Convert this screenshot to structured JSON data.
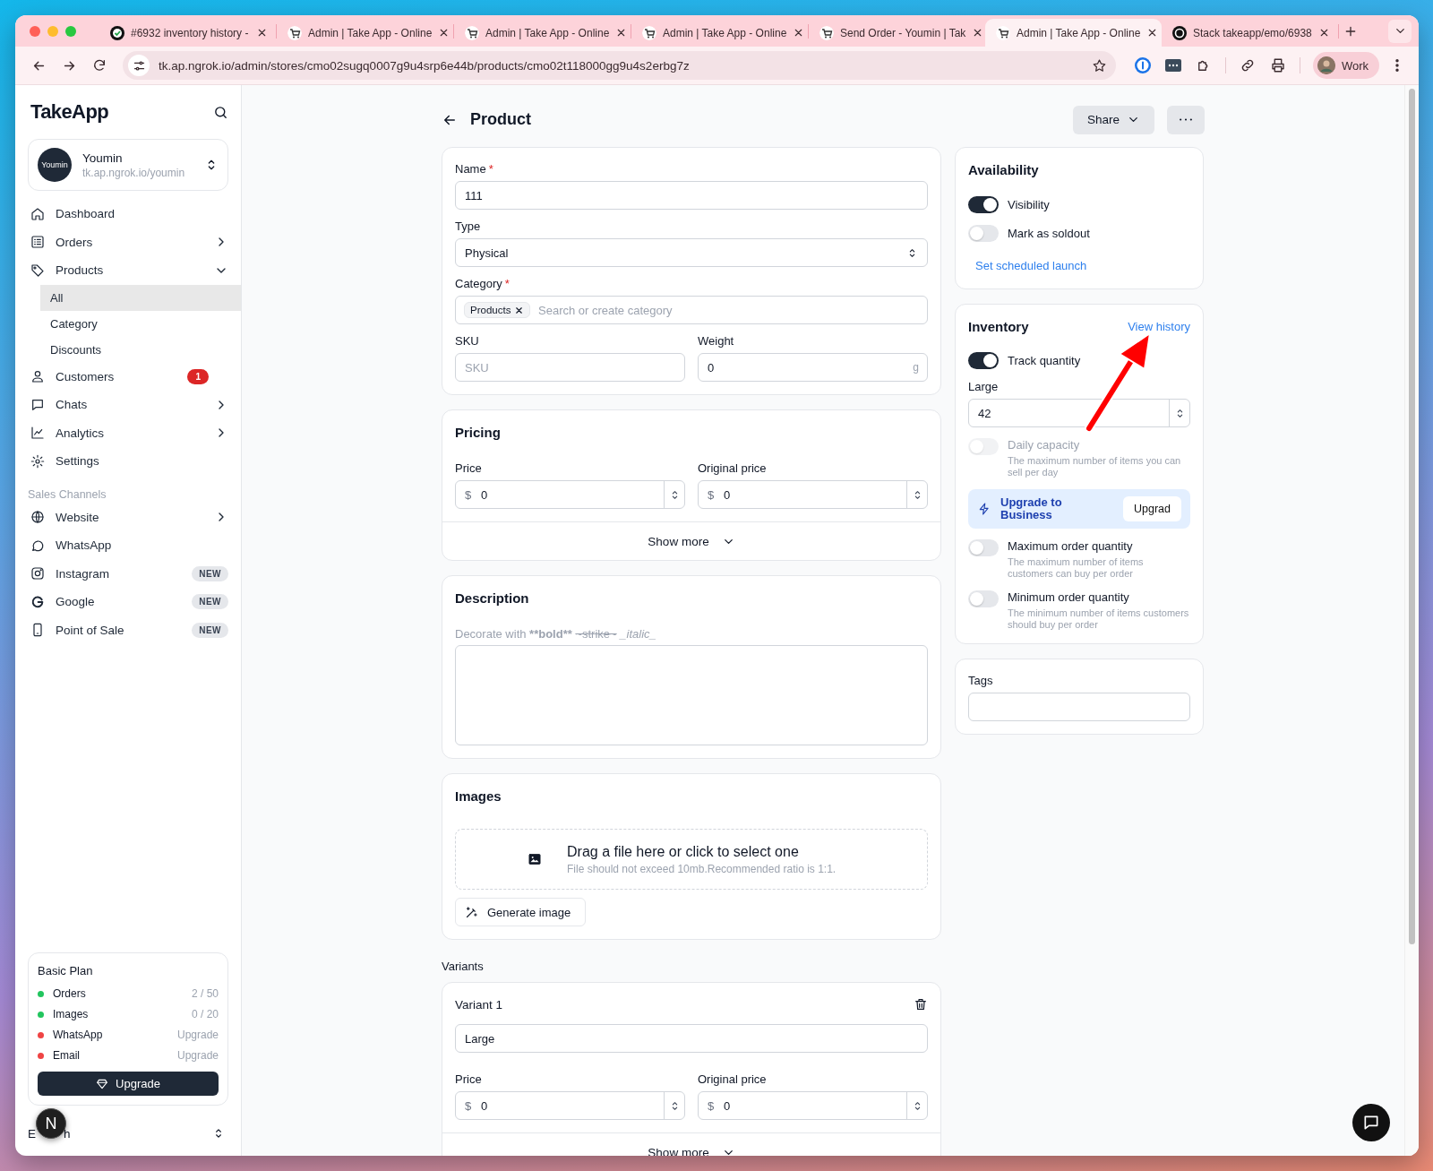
{
  "browser": {
    "tabs": [
      {
        "kind": "badge",
        "title": "#6932 inventory history -",
        "selected": false
      },
      {
        "kind": "cart",
        "title": "Admin | Take App - Online",
        "selected": false
      },
      {
        "kind": "cart",
        "title": "Admin | Take App - Online",
        "selected": false
      },
      {
        "kind": "cart",
        "title": "Admin | Take App - Online",
        "selected": false
      },
      {
        "kind": "cart",
        "title": "Send Order - Youmin | Tak",
        "selected": false
      },
      {
        "kind": "cart",
        "title": "Admin | Take App - Online",
        "selected": true
      },
      {
        "kind": "logo",
        "title": "Stack takeapp/emo/6938",
        "selected": false
      }
    ],
    "url": "tk.ap.ngrok.io/admin/stores/cmo02sugq0007g9u4srp6e44b/products/cmo02t118000gg9u4s2erbg7z",
    "profile": "Work"
  },
  "sidebar": {
    "logo": "TakeApp",
    "store": {
      "avatar": "Youmin",
      "name": "Youmin",
      "url": "tk.ap.ngrok.io/youmin"
    },
    "nav": [
      {
        "kind": "link",
        "label": "Dashboard",
        "selected": false
      },
      {
        "kind": "group",
        "label": "Orders",
        "expanded": false,
        "selected": false
      },
      {
        "kind": "group",
        "label": "Products",
        "expanded": true,
        "selected": false,
        "children": [
          {
            "label": "All",
            "selected": true
          },
          {
            "label": "Category",
            "selected": false
          },
          {
            "label": "Discounts",
            "selected": false
          }
        ]
      },
      {
        "kind": "link",
        "label": "Customers",
        "badge": "1",
        "selected": false
      },
      {
        "kind": "group",
        "label": "Chats",
        "expanded": false,
        "selected": false
      },
      {
        "kind": "group",
        "label": "Analytics",
        "expanded": false,
        "selected": false
      },
      {
        "kind": "link",
        "label": "Settings",
        "selected": false
      }
    ],
    "channels_title": "Sales Channels",
    "channels": [
      {
        "kind": "group",
        "label": "Website",
        "expanded": false,
        "selected": false
      },
      {
        "kind": "link",
        "label": "WhatsApp",
        "selected": false
      },
      {
        "kind": "link",
        "label": "Instagram",
        "tag": "NEW",
        "selected": false
      },
      {
        "kind": "link",
        "label": "Google",
        "tag": "NEW",
        "selected": false
      },
      {
        "kind": "link",
        "label": "Point of Sale",
        "tag": "NEW",
        "selected": false
      }
    ],
    "plan": {
      "title": "Basic Plan",
      "items": [
        {
          "label": "Orders",
          "value": "2 / 50",
          "color": "#22c55e"
        },
        {
          "label": "Images",
          "value": "0 / 20",
          "color": "#22c55e"
        },
        {
          "label": "WhatsApp",
          "value": "Upgrade",
          "color": "#ef4444"
        },
        {
          "label": "Email",
          "value": "Upgrade",
          "color": "#ef4444"
        }
      ],
      "button": "Upgrade"
    },
    "language": [
      "E",
      "h"
    ],
    "dev_badge": "N"
  },
  "page": {
    "title": "Product",
    "share": "Share"
  },
  "details": {
    "name": {
      "label": "Name",
      "mark": "*",
      "value": "111"
    },
    "type": {
      "label": "Type",
      "value": "Physical"
    },
    "category": {
      "label": "Category",
      "mark": "*",
      "chips": [
        "Products"
      ],
      "placeholder": "Search or create category"
    },
    "sku": {
      "label": "SKU",
      "placeholder": "SKU"
    },
    "weight": {
      "label": "Weight",
      "value": "0",
      "unit": "g"
    }
  },
  "pricing": {
    "title": "Pricing",
    "price": {
      "label": "Price",
      "currency": "$",
      "value": "0"
    },
    "original_price": {
      "label": "Original price",
      "currency": "$",
      "value": "0"
    },
    "show_more": "Show more"
  },
  "description": {
    "title": "Description",
    "hint": [
      {
        "kind": "plain",
        "text": "Decorate with"
      },
      {
        "kind": "bold",
        "text": "**bold**"
      },
      {
        "kind": "strike",
        "text": "~strike~"
      },
      {
        "kind": "italic",
        "text": "_italic_"
      }
    ]
  },
  "images": {
    "title": "Images",
    "drop_title": "Drag a file here or click to select one",
    "drop_hint": "File should not exceed 10mb.Recommended ratio is 1:1.",
    "generate": "Generate image"
  },
  "variants": {
    "title": "Variants",
    "items": [
      {
        "name": "Variant 1",
        "value": "Large",
        "price": {
          "label": "Price",
          "currency": "$",
          "value": "0"
        },
        "original_price": {
          "label": "Original price",
          "currency": "$",
          "value": "0"
        },
        "show_more": "Show more"
      }
    ]
  },
  "availability": {
    "title": "Availability",
    "toggles": [
      {
        "label": "Visibility",
        "on": true
      },
      {
        "label": "Mark as soldout",
        "on": false
      }
    ],
    "link": "Set scheduled launch"
  },
  "inventory": {
    "title": "Inventory",
    "link": "View history",
    "track": {
      "label": "Track quantity",
      "on": true
    },
    "stock": [
      {
        "label": "Large",
        "value": "42"
      }
    ],
    "options": [
      {
        "kind": "toggle",
        "label": "Daily capacity",
        "on": false,
        "disabled": true,
        "hint": "The maximum number of items you can sell per day"
      },
      {
        "kind": "banner",
        "title": "Upgrade to Business",
        "button": "Upgrad"
      },
      {
        "kind": "toggle",
        "label": "Maximum order quantity",
        "on": false,
        "disabled": false,
        "hint": "The maximum number of items customers can buy per order"
      },
      {
        "kind": "toggle",
        "label": "Minimum order quantity",
        "on": false,
        "disabled": false,
        "hint": "The minimum number of items customers should buy per order"
      }
    ]
  },
  "tags": {
    "label": "Tags"
  }
}
